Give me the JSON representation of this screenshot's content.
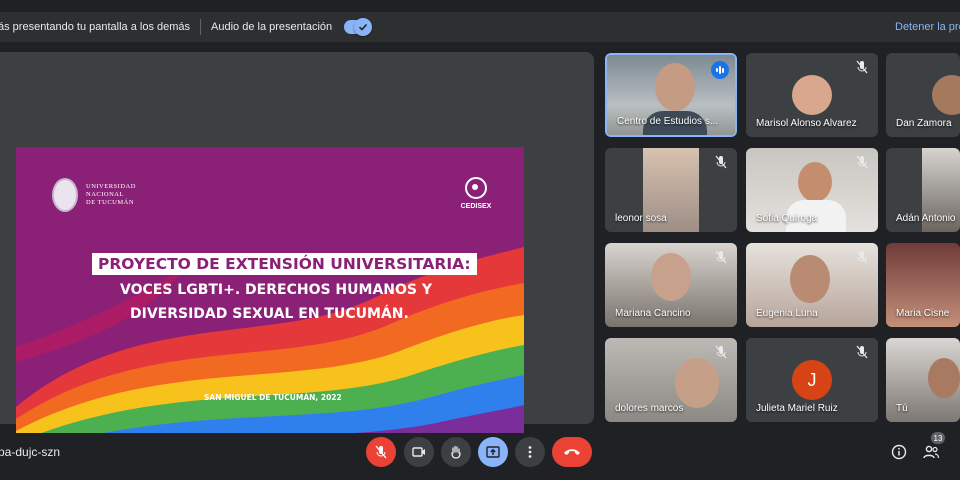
{
  "banner": {
    "presenting_text": "ás presentando tu pantalla a los demás",
    "audio_label": "Audio de la presentación",
    "stop_label": "Detener la pre"
  },
  "slide": {
    "university": "UNIVERSIDAD\nNACIONAL\nDE TUCUMÁN",
    "org": "CEDISEX",
    "title_line1": "PROYECTO DE EXTENSIÓN UNIVERSITARIA:",
    "title_line2": "VOCES LGBTI+. DERECHOS HUMANOS Y",
    "title_line3": "DIVERSIDAD SEXUAL EN TUCUMÁN.",
    "footer": "SAN MIGUEL DE TUCUMÁN, 2022"
  },
  "participants": [
    {
      "name": "Centro de Estudios s..."
    },
    {
      "name": "Marisol Alonso Alvarez"
    },
    {
      "name": "Dan Zamora"
    },
    {
      "name": "leonor sosa"
    },
    {
      "name": "Sofia Quiroga"
    },
    {
      "name": "Adán Antonio"
    },
    {
      "name": "Mariana Cancino"
    },
    {
      "name": "Eugenia Luna"
    },
    {
      "name": "Maria Cisne"
    },
    {
      "name": "dolores marcos"
    },
    {
      "name": "Julieta Mariel Ruiz",
      "initial": "J"
    },
    {
      "name": "Tú"
    }
  ],
  "bottom": {
    "meeting_code": "pa-dujc-szn",
    "participant_count": "13"
  },
  "colors": {
    "accent": "#8ab4f8",
    "danger": "#ea4335",
    "slide_bg": "#8b2176",
    "avatar_j": "#d84315"
  }
}
